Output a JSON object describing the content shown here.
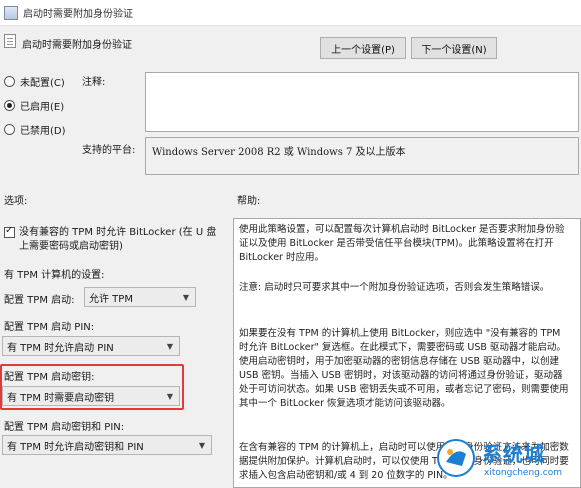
{
  "window": {
    "title": "启动时需要附加身份验证"
  },
  "header": {
    "policy_name": "启动时需要附加身份验证",
    "prev_button": "上一个设置(P)",
    "next_button": "下一个设置(N)"
  },
  "state": {
    "options": [
      {
        "label": "未配置(C)",
        "selected": false
      },
      {
        "label": "已启用(E)",
        "selected": true
      },
      {
        "label": "已禁用(D)",
        "selected": false
      }
    ]
  },
  "comment": {
    "label": "注释:",
    "value": ""
  },
  "platform": {
    "label": "支持的平台:",
    "value": "Windows Server 2008 R2 或 Windows 7 及以上版本"
  },
  "options_pane": {
    "label": "选项:",
    "allow_no_tpm": {
      "text": "没有兼容的 TPM 时允许 BitLocker (在 U 盘上需要密码或启动密钥)",
      "checked": true
    },
    "tpm_settings_label": "有 TPM 计算机的设置:",
    "tpm_startup": {
      "label": "配置 TPM 启动:",
      "value": "允许 TPM"
    },
    "tpm_startup_pin": {
      "label": "配置 TPM 启动 PIN:",
      "value": "有 TPM 时允许启动 PIN"
    },
    "tpm_startup_key": {
      "label": "配置 TPM 启动密钥:",
      "value": "有 TPM 时需要启动密钥"
    },
    "tpm_startup_key_pin": {
      "label": "配置 TPM 启动密钥和 PIN:",
      "value": "有 TPM 时允许启动密钥和 PIN"
    }
  },
  "help_pane": {
    "label": "帮助:",
    "paragraphs": [
      "使用此策略设置，可以配置每次计算机启动时 BitLocker 是否要求附加身份验证以及使用 BitLocker 是否带受信任平台模块(TPM)。此策略设置将在打开 BitLocker 时应用。",
      "注意: 启动时只可要求其中一个附加身份验证选项，否则会发生策略错误。",
      "如果要在没有 TPM 的计算机上使用 BitLocker，则应选中 \"没有兼容的 TPM 时允许 BitLocker\" 复选框。在此模式下，需要密码或 USB 驱动器才能启动。使用启动密钥时，用于加密驱动器的密钥信息存储在 USB 驱动器中，以创建 USB 密钥。当插入 USB 密钥时，对该驱动器的访问将通过身份验证，驱动器处于可访问状态。如果 USB 密钥丢失或不可用，或者忘记了密码，则需要使用其中一个 BitLocker 恢复选项才能访问该驱动器。",
      "在含有兼容的 TPM 的计算机上，启动时可以使用四种身份验证方法来为加密数据提供附加保护。计算机启动时，可以仅使用 TPM 进行身份验证，也可同时要求插入包含启动密钥和/或 4 到 20 位数字的 PIN。"
    ]
  },
  "watermark": {
    "brand": "系统城",
    "url": "xitongcheng.com"
  }
}
